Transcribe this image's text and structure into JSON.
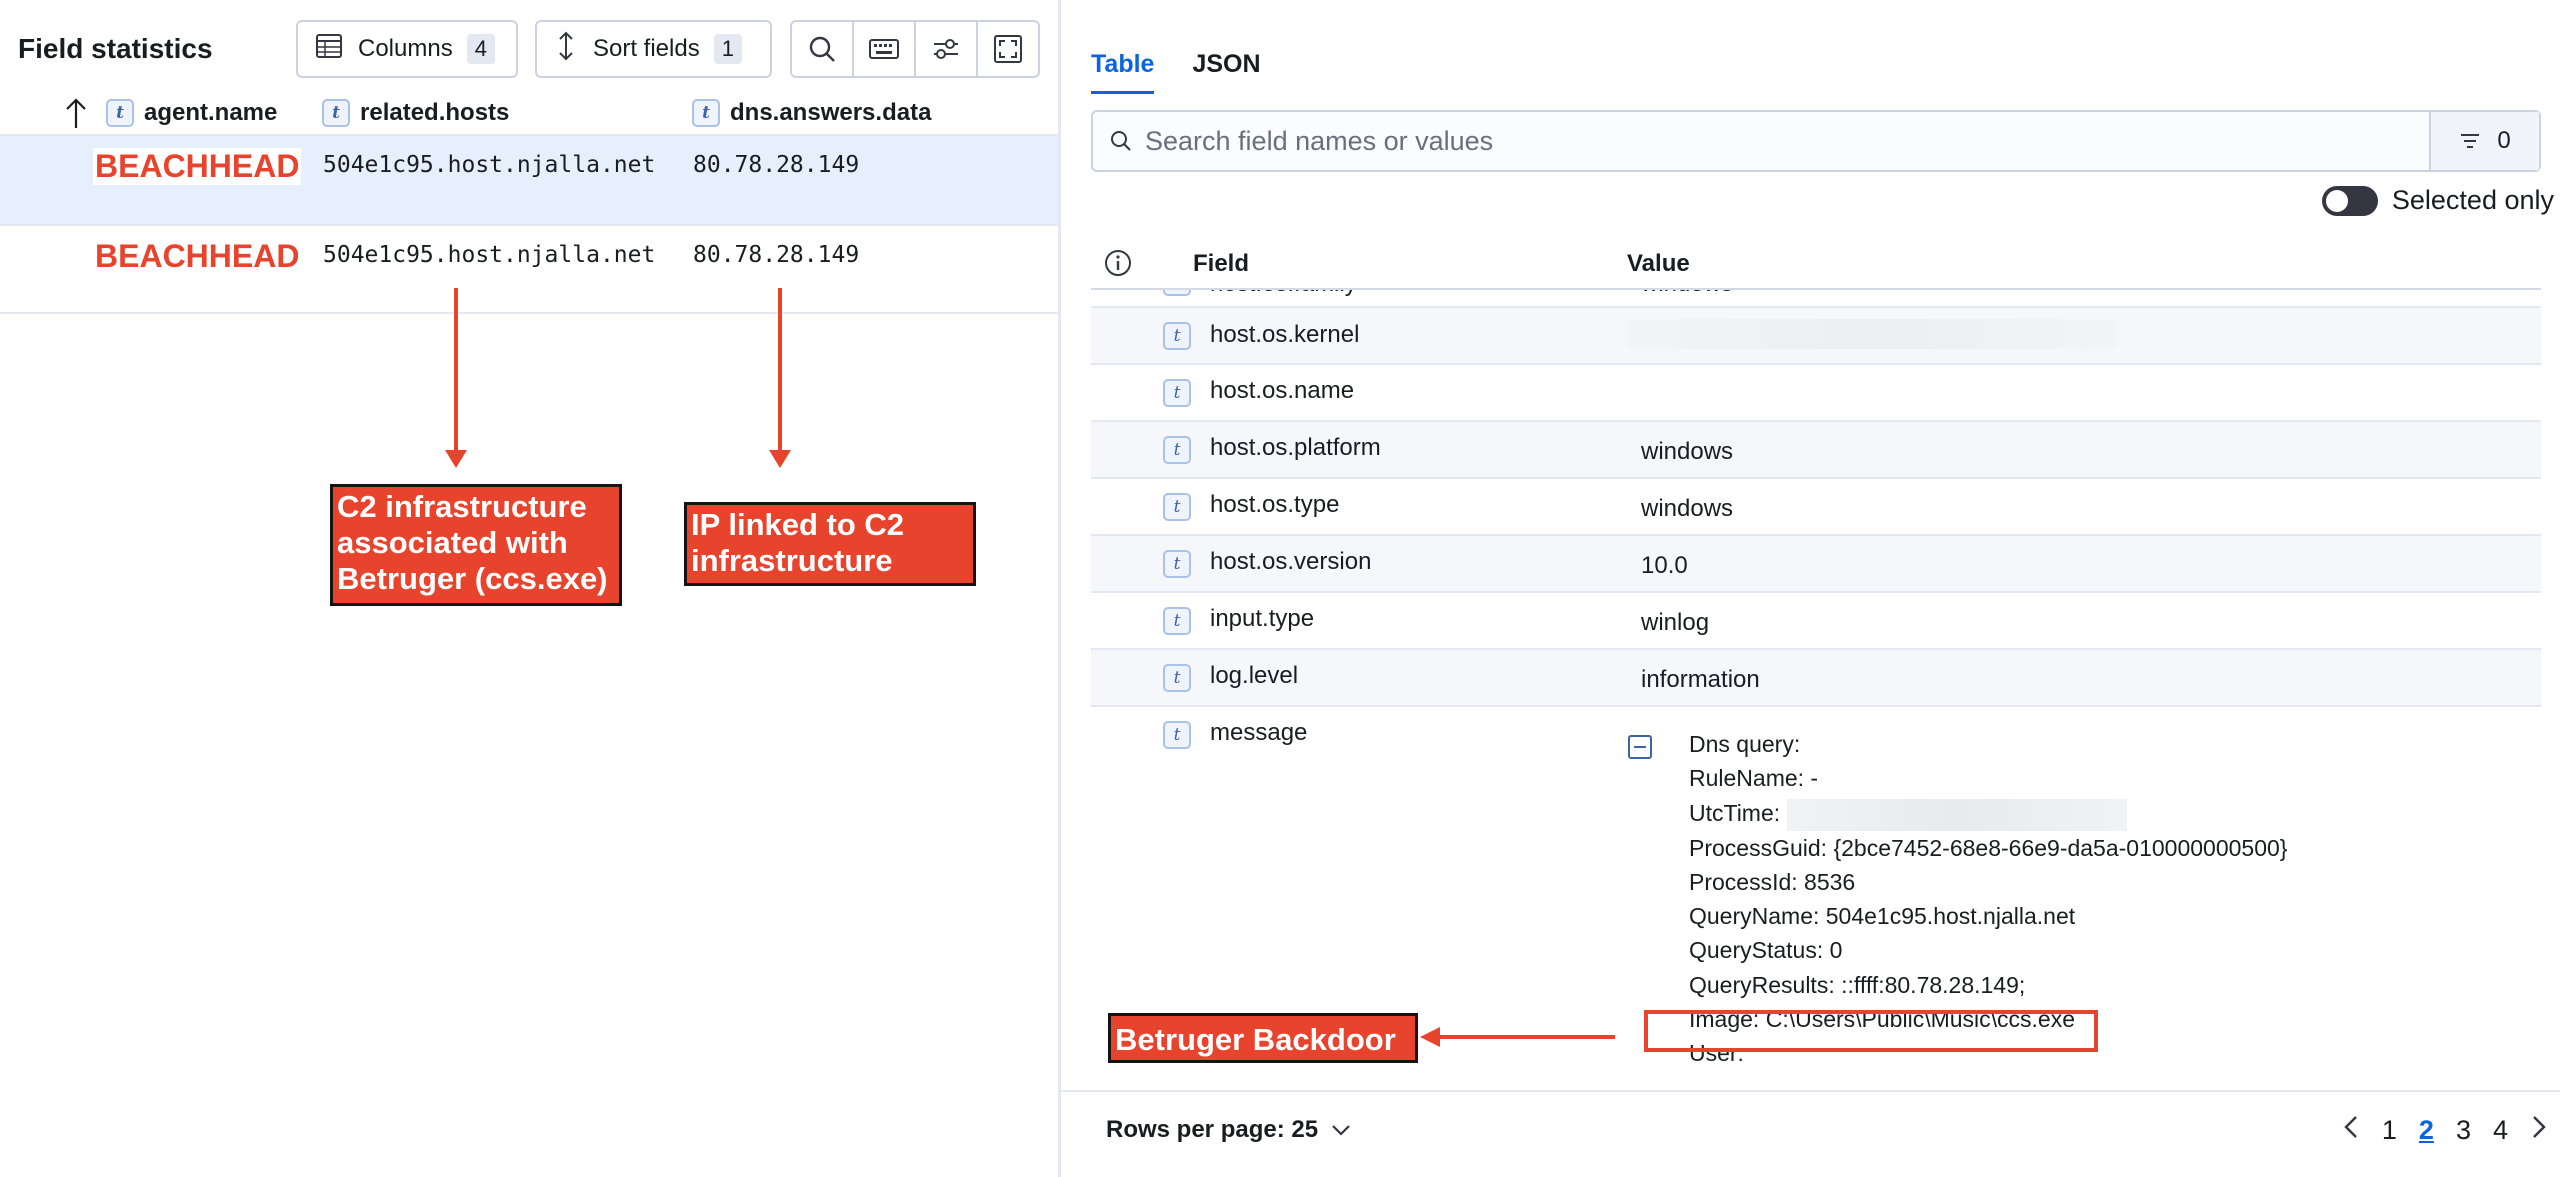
{
  "left_panel": {
    "title": "Field statistics",
    "toolbar": {
      "columns_label": "Columns",
      "columns_count": "4",
      "sort_label": "Sort fields",
      "sort_count": "1"
    },
    "headers": [
      {
        "type": "t",
        "name": "agent.name"
      },
      {
        "type": "t",
        "name": "related.hosts"
      },
      {
        "type": "t",
        "name": "dns.answers.data"
      }
    ],
    "rows": [
      {
        "agent": "BEACHHEAD",
        "host": "504e1c95.host.njalla.net",
        "ip": "80.78.28.149"
      },
      {
        "agent": "BEACHHEAD",
        "host": "504e1c95.host.njalla.net",
        "ip": "80.78.28.149"
      }
    ]
  },
  "annotations": {
    "c2_infra": "C2 infrastructure associated with Betruger (ccs.exe)",
    "c2_infra_lines": [
      "C2 infrastructure",
      "associated with",
      "Betruger (ccs.exe)"
    ],
    "ip_linked_lines": [
      "IP linked to C2",
      "infrastructure"
    ],
    "backdoor": "Betruger Backdoor",
    "color": "#e8432d"
  },
  "right_panel": {
    "tabs": [
      "Table",
      "JSON"
    ],
    "active_tab": "Table",
    "search": {
      "placeholder": "Search field names or values",
      "filter_count": "0"
    },
    "selected_only_label": "Selected only",
    "columns": {
      "field": "Field",
      "value": "Value"
    },
    "rows": [
      {
        "type": "t",
        "field": "host.os.family",
        "value": "windows"
      },
      {
        "type": "t",
        "field": "host.os.kernel",
        "value": ""
      },
      {
        "type": "t",
        "field": "host.os.name",
        "value": ""
      },
      {
        "type": "t",
        "field": "host.os.platform",
        "value": "windows"
      },
      {
        "type": "t",
        "field": "host.os.type",
        "value": "windows"
      },
      {
        "type": "t",
        "field": "host.os.version",
        "value": "10.0"
      },
      {
        "type": "t",
        "field": "input.type",
        "value": "winlog"
      },
      {
        "type": "t",
        "field": "log.level",
        "value": "information"
      },
      {
        "type": "t",
        "field": "message",
        "value": ""
      }
    ],
    "message_lines": [
      "Dns query:",
      "RuleName: -",
      "UtcTime:",
      "ProcessGuid: {2bce7452-68e8-66e9-da5a-010000000500}",
      "ProcessId: 8536",
      "QueryName: 504e1c95.host.njalla.net",
      "QueryStatus: 0",
      "QueryResults: ::ffff:80.78.28.149;",
      "Image: C:\\Users\\Public\\Music\\ccs.exe",
      "User:"
    ],
    "footer": {
      "rows_per_page": "Rows per page: 25",
      "pages": [
        "1",
        "2",
        "3",
        "4"
      ],
      "current_page": "2"
    }
  },
  "icon_names": [
    "table-icon",
    "sort-icon",
    "search-icon",
    "keyboard-icon",
    "settings-sliders-icon",
    "fullscreen-icon",
    "info-icon",
    "filter-icon",
    "chevron-down-icon",
    "chevron-left-icon",
    "chevron-right-icon",
    "arrow-up-icon",
    "collapse-icon"
  ]
}
